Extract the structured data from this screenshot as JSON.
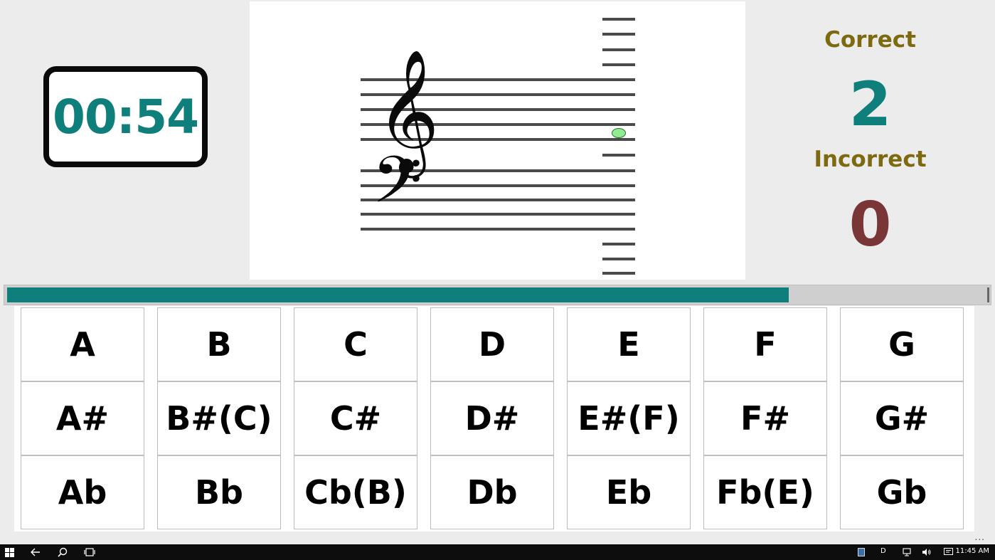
{
  "timer": {
    "value": "00:54"
  },
  "score": {
    "correct_label": "Correct",
    "correct_value": "2",
    "incorrect_label": "Incorrect",
    "incorrect_value": "0"
  },
  "progress": {
    "fraction": 0.797
  },
  "colors": {
    "accent": "#0f7f7b",
    "label": "#7d6a10",
    "incorrect": "#7a3636",
    "note": "#90ee90"
  },
  "staff": {
    "clefs": [
      "treble-clef",
      "bass-clef"
    ],
    "note_position": "treble staff, between bottom two lines (F)"
  },
  "keypad": {
    "rows": [
      [
        "A",
        "B",
        "C",
        "D",
        "E",
        "F",
        "G"
      ],
      [
        "A#",
        "B#(C)",
        "C#",
        "D#",
        "E#(F)",
        "F#",
        "G#"
      ],
      [
        "Ab",
        "Bb",
        "Cb(B)",
        "Db",
        "Eb",
        "Fb(E)",
        "Gb"
      ]
    ]
  },
  "taskbar": {
    "icons": [
      "windows-start-icon",
      "back-icon",
      "search-icon",
      "task-view-icon"
    ],
    "tray_icons": [
      "tray-app-icon",
      "network-icon",
      "volume-icon",
      "notifications-icon"
    ],
    "language": "D",
    "time": "11:45 AM"
  },
  "more_label": "..."
}
